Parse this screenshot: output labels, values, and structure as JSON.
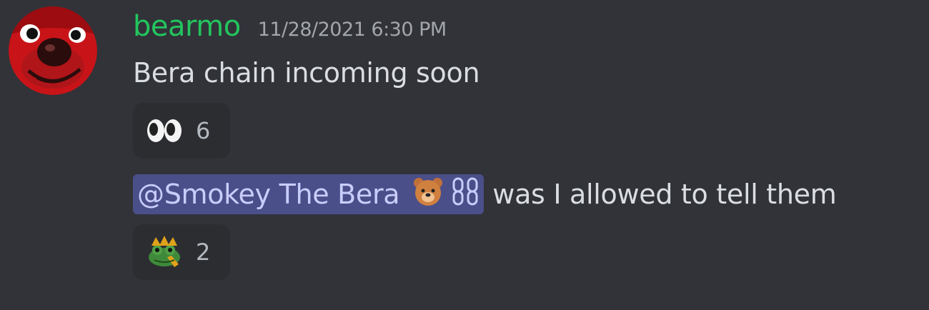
{
  "message": {
    "author": "bearmo",
    "timestamp": "11/28/2021 6:30 PM",
    "line1": "Bera chain incoming soon",
    "mention": "@Smokey The Bera",
    "line2_rest": "was I allowed to tell them"
  },
  "reactions": [
    {
      "icon": "eyes-emoji",
      "count": "6"
    },
    {
      "icon": "frog-crown-emoji",
      "count": "2"
    }
  ],
  "colors": {
    "background": "#313338",
    "username": "#23c55e",
    "mention_bg": "#4a4f8a",
    "reaction_bg": "#2b2d31"
  }
}
